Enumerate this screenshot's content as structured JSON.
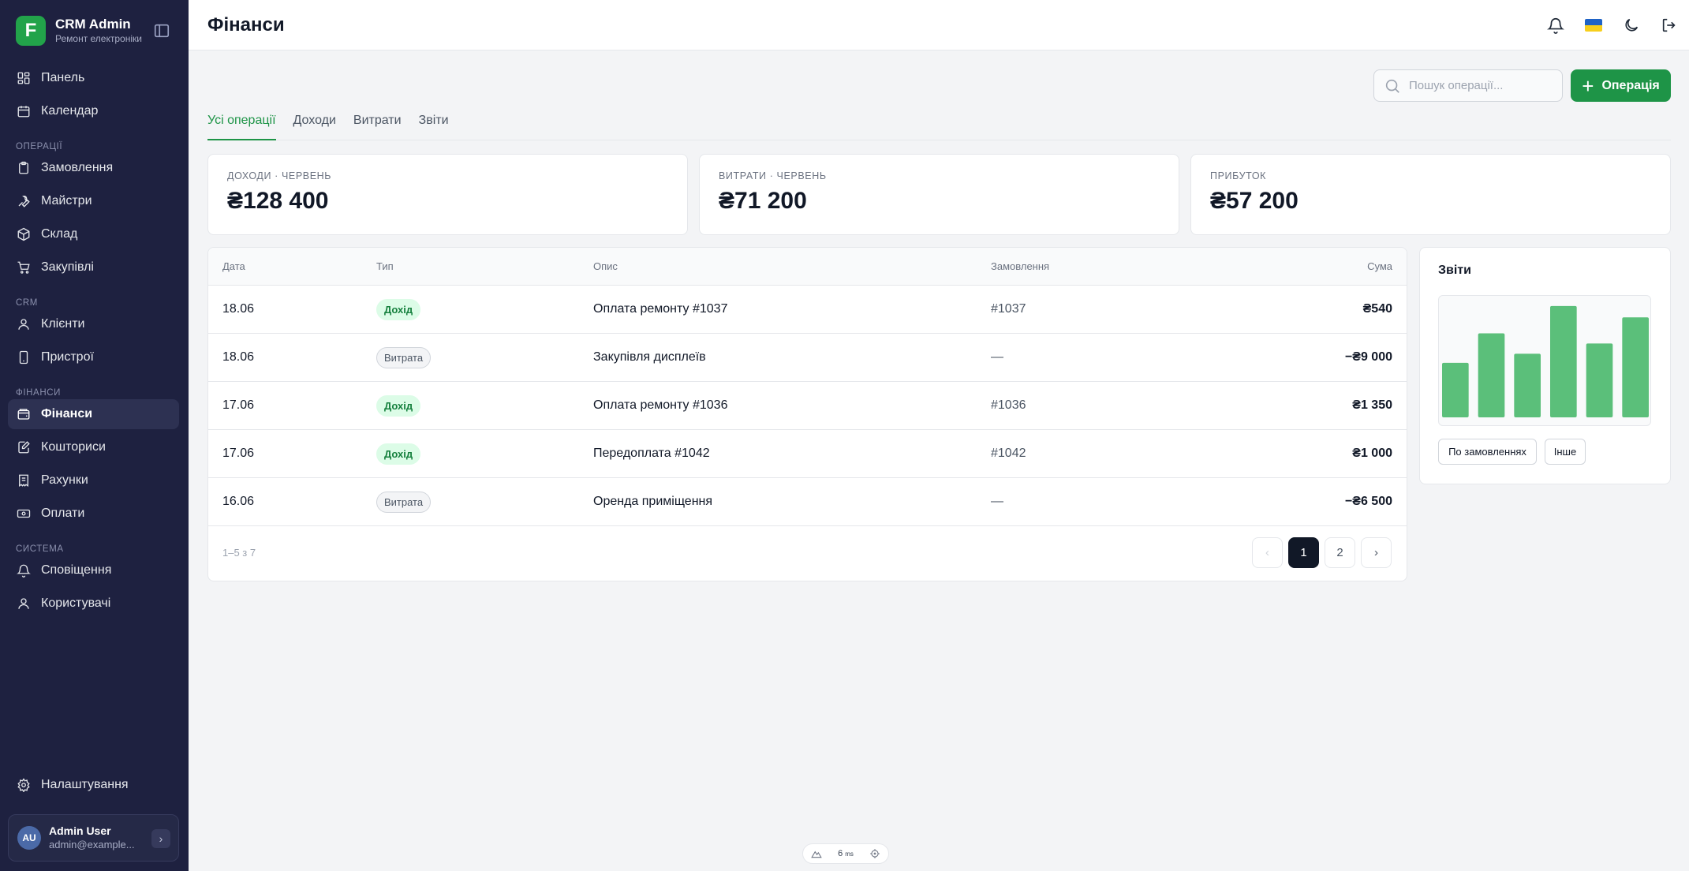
{
  "brand": {
    "logo_letter": "F",
    "name": "CRM Admin",
    "subtitle": "Ремонт електроніки"
  },
  "sidebar": {
    "top_items": [
      {
        "label": "Панель",
        "icon": "dashboard-icon"
      },
      {
        "label": "Календар",
        "icon": "calendar-icon"
      }
    ],
    "sections": {
      "operations": {
        "title": "ОПЕРАЦІЇ",
        "items": [
          "Замовлення",
          "Майстри",
          "Склад",
          "Закупівлі"
        ]
      },
      "crm": {
        "title": "CRM",
        "items": [
          "Клієнти",
          "Пристрої"
        ]
      },
      "finance": {
        "title": "ФІНАНСИ",
        "items": [
          "Фінанси",
          "Кошториси",
          "Рахунки",
          "Оплати"
        ]
      },
      "system": {
        "title": "СИСТЕМА",
        "items": [
          "Сповіщення",
          "Користувачі"
        ]
      }
    },
    "active_item": "Фінанси",
    "settings_label": "Налаштування"
  },
  "user": {
    "initials": "AU",
    "name": "Admin User",
    "email": "admin@example..."
  },
  "header": {
    "title": "Фінанси"
  },
  "toolbar": {
    "search_placeholder": "Пошук операції...",
    "add_label": "Операція"
  },
  "tabs": [
    "Усі операції",
    "Доходи",
    "Витрати",
    "Звіти"
  ],
  "active_tab": "Усі операції",
  "stats": [
    {
      "label": "ДОХОДИ · ЧЕРВЕНЬ",
      "value": "₴128 400"
    },
    {
      "label": "ВИТРАТИ · ЧЕРВЕНЬ",
      "value": "₴71 200"
    },
    {
      "label": "ПРИБУТОК",
      "value": "₴57 200"
    }
  ],
  "table": {
    "columns": [
      "Дата",
      "Тип",
      "Опис",
      "Замовлення",
      "Сума"
    ],
    "rows": [
      {
        "date": "18.06",
        "type": "Дохід",
        "kind": "income",
        "desc": "Оплата ремонту #1037",
        "order": "#1037",
        "sum": "₴540"
      },
      {
        "date": "18.06",
        "type": "Витрата",
        "kind": "expense",
        "desc": "Закупівля дисплеїв",
        "order": "—",
        "sum": "−₴9 000"
      },
      {
        "date": "17.06",
        "type": "Дохід",
        "kind": "income",
        "desc": "Оплата ремонту #1036",
        "order": "#1036",
        "sum": "₴1 350"
      },
      {
        "date": "17.06",
        "type": "Дохід",
        "kind": "income",
        "desc": "Передоплата #1042",
        "order": "#1042",
        "sum": "₴1 000"
      },
      {
        "date": "16.06",
        "type": "Витрата",
        "kind": "expense",
        "desc": "Оренда приміщення",
        "order": "—",
        "sum": "−₴6 500"
      }
    ],
    "range_text": "1–5 з 7",
    "pagination": {
      "prev": "‹",
      "pages": [
        "1",
        "2"
      ],
      "current": "1",
      "next": "›"
    }
  },
  "reports": {
    "title": "Звіти",
    "bar_levels": [
      0.48,
      0.74,
      0.56,
      0.98,
      0.65,
      0.88
    ],
    "bar_color": "#5bbf7a",
    "buttons": [
      "По замовленнях",
      "Інше"
    ]
  },
  "dev_indicator": {
    "value": "6",
    "unit": "ms"
  },
  "colors": {
    "sidebar_bg": "#1e2140",
    "accent": "#1e9447",
    "income_badge": "#dcfce7"
  }
}
